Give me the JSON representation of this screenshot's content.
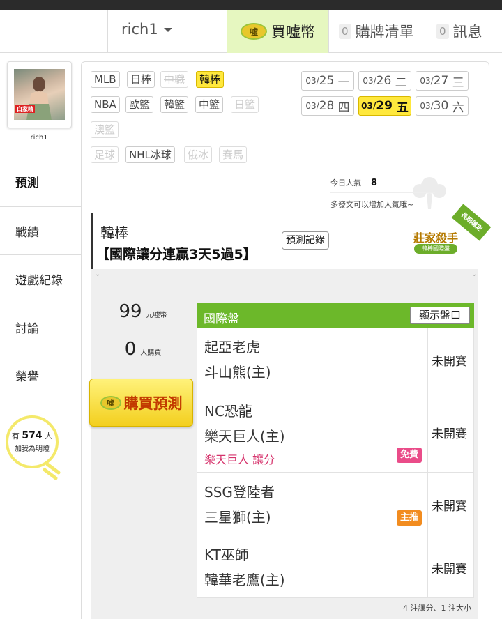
{
  "header": {
    "username": "rich1",
    "buy_coins_label": "買嘘幣",
    "coin_icon_text": "噓",
    "watchlist_count": "0",
    "watchlist_label": "購牌清單",
    "messages_count": "0",
    "messages_label": "訊息"
  },
  "sidebar": {
    "avatar_tag": "白家精",
    "username": "rich1",
    "items": [
      {
        "label": "預測"
      },
      {
        "label": "戰績"
      },
      {
        "label": "遊戲紀錄"
      },
      {
        "label": "討論"
      },
      {
        "label": "榮譽"
      }
    ],
    "lightbulb": {
      "prefix": "有",
      "count": "574",
      "suffix": "人",
      "line2": "加我為明燈"
    }
  },
  "sports": {
    "row1": [
      {
        "label": "MLB",
        "state": "normal"
      },
      {
        "label": "日棒",
        "state": "normal"
      },
      {
        "label": "中職",
        "state": "disabled"
      },
      {
        "label": "韓棒",
        "state": "selected"
      }
    ],
    "row2": [
      {
        "label": "NBA",
        "state": "normal"
      },
      {
        "label": "歐籃",
        "state": "normal"
      },
      {
        "label": "韓籃",
        "state": "normal"
      },
      {
        "label": "中籃",
        "state": "normal"
      },
      {
        "label": "日籃",
        "state": "disabled"
      }
    ],
    "row3": [
      {
        "label": "澳籃",
        "state": "disabled"
      }
    ],
    "row4": [
      {
        "label": "足球",
        "state": "disabled"
      },
      {
        "label": "NHL冰球",
        "state": "normal"
      },
      {
        "label": "俄冰",
        "state": "disabled"
      },
      {
        "label": "賽馬",
        "state": "disabled"
      }
    ]
  },
  "dates": [
    {
      "month": "03/",
      "day": "25",
      "weekday": "一",
      "selected": false
    },
    {
      "month": "03/",
      "day": "26",
      "weekday": "二",
      "selected": false
    },
    {
      "month": "03/",
      "day": "27",
      "weekday": "三",
      "selected": false
    },
    {
      "month": "03/",
      "day": "28",
      "weekday": "四",
      "selected": false
    },
    {
      "month": "03/",
      "day": "29",
      "weekday": "五",
      "selected": true
    },
    {
      "month": "03/",
      "day": "30",
      "weekday": "六",
      "selected": false
    }
  ],
  "popularity": {
    "label": "今日人氣",
    "value": "8",
    "note": "多發文可以增加人氣哦~"
  },
  "prediction": {
    "league": "韓棒",
    "headline": "【國際讓分連贏3天5過5】",
    "record_button": "預測記錄",
    "badge_title": "莊家殺手",
    "badge_sub": "韓棒國際盤",
    "ribbon": "長期穩定"
  },
  "stats": {
    "price": "99",
    "price_unit": "元噓幣",
    "buyers": "0",
    "buyers_unit": "人購買",
    "buy_button": "購買預測"
  },
  "odds": {
    "title": "國際盤",
    "show_button": "顯示盤口",
    "games": [
      {
        "away": "起亞老虎",
        "home": "斗山熊(主)",
        "status": "未開賽",
        "handicap": "",
        "tag": ""
      },
      {
        "away": "NC恐龍",
        "home": "樂天巨人(主)",
        "status": "未開賽",
        "handicap": "樂天巨人 讓分",
        "tag": "免費"
      },
      {
        "away": "SSG登陸者",
        "home": "三星獅(主)",
        "status": "未開賽",
        "handicap": "",
        "tag": "主推"
      },
      {
        "away": "KT巫師",
        "home": "韓華老鷹(主)",
        "status": "未開賽",
        "handicap": "",
        "tag": ""
      }
    ],
    "summary": "4 注讓分、1 注大小"
  }
}
